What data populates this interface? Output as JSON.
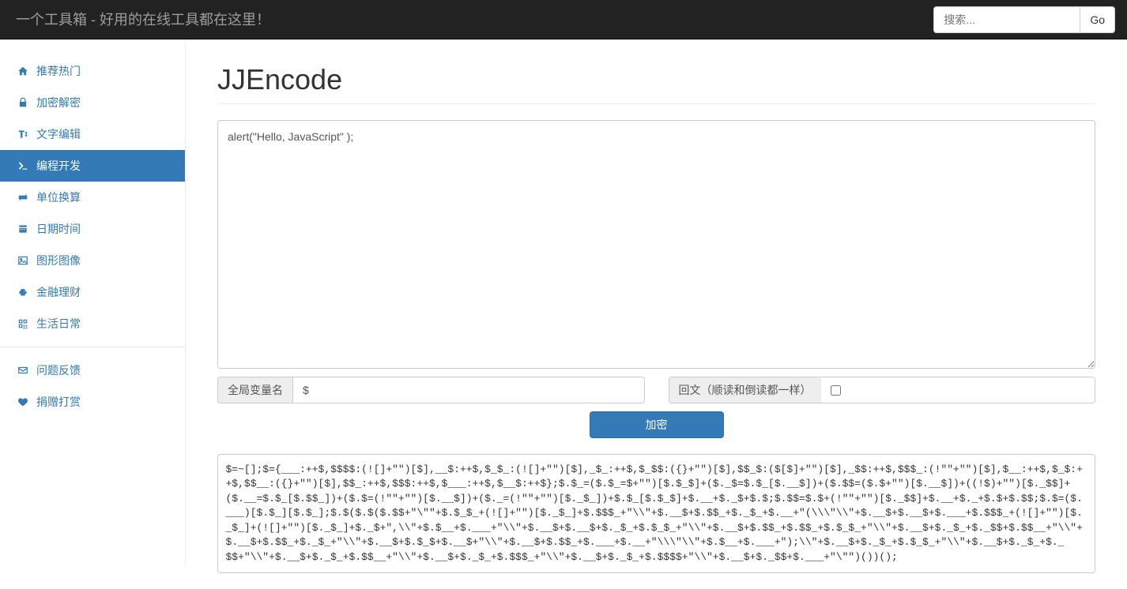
{
  "header": {
    "brand": "一个工具箱 - 好用的在线工具都在这里！",
    "search_placeholder": "搜索...",
    "go_label": "Go"
  },
  "sidebar": {
    "items": [
      {
        "label": "推荐热门"
      },
      {
        "label": "加密解密"
      },
      {
        "label": "文字编辑"
      },
      {
        "label": "编程开发"
      },
      {
        "label": "单位换算"
      },
      {
        "label": "日期时间"
      },
      {
        "label": "图形图像"
      },
      {
        "label": "金融理财"
      },
      {
        "label": "生活日常"
      }
    ],
    "feedback_label": "问题反馈",
    "donate_label": "捐赠打赏"
  },
  "page": {
    "title": "JJEncode",
    "input_value": "alert(\"Hello, JavaScript\" );",
    "global_var_label": "全局变量名",
    "global_var_value": "$",
    "palindrome_label": "回文（顺读和倒读都一样）",
    "submit_label": "加密",
    "output": "$=~[];$={___:++$,$$$$:(![]+\"\")[$],__$:++$,$_$_:(![]+\"\")[$],_$_:++$,$_$$:({}+\"\")[$],$$_$:($[$]+\"\")[$],_$$:++$,$$$_:(!\"\"+\"\")[$],$__:++$,$_$:++$,$$__:({}+\"\")[$],$$_:++$,$$$:++$,$___:++$,$__$:++$};$.$_=($.$_=$+\"\")[$.$_$]+($._$=$.$_[$.__$])+($.$$=($.$+\"\")[$.__$])+((!$)+\"\")[$._$$]+($.__=$.$_[$.$$_])+($.$=(!\"\"+\"\")[$.__$])+($._=(!\"\"+\"\")[$._$_])+$.$_[$.$_$]+$.__+$._$+$.$;$.$$=$.$+(!\"\"+\"\")[$._$$]+$.__+$._+$.$+$.$$;$.$=($.___)[$.$_][$.$_];$.$($.$($.$$+\"\\\"\"+$.$_$_+(![]+\"\")[$._$_]+$.$$$_+\"\\\\\"+$.__$+$.$$_+$._$_+$.__+\"(\\\\\\\"\\\\\"+$.__$+$.__$+$.___+$.$$$_+(![]+\"\")[$._$_]+(![]+\"\")[$._$_]+$._$+\",\\\\\"+$.$__+$.___+\"\\\\\"+$.__$+$.__$+$._$_+$.$_$_+\"\\\\\"+$.__$+$.$$_+$.$$_+$.$_$_+\"\\\\\"+$.__$+$._$_+$._$$+$.$$__+\"\\\\\"+$.__$+$.$$_+$._$_+\"\\\\\"+$.__$+$.$_$+$.__$+\"\\\\\"+$.__$+$.$$_+$.___+$.__+\"\\\\\\\"\\\\\"+$.$__+$.___+\");\\\\\"+$.__$+$._$_+$.$_$_+\"\\\\\"+$.__$+$._$_+$._$$+\"\\\\\"+$.__$+$._$_+$.$$__+\"\\\\\"+$.__$+$._$_+$.$$$_+\"\\\\\"+$.__$+$._$_+$.$$$$+\"\\\\\"+$.__$+$._$$+$.___+\"\\\"\")())();"
  }
}
